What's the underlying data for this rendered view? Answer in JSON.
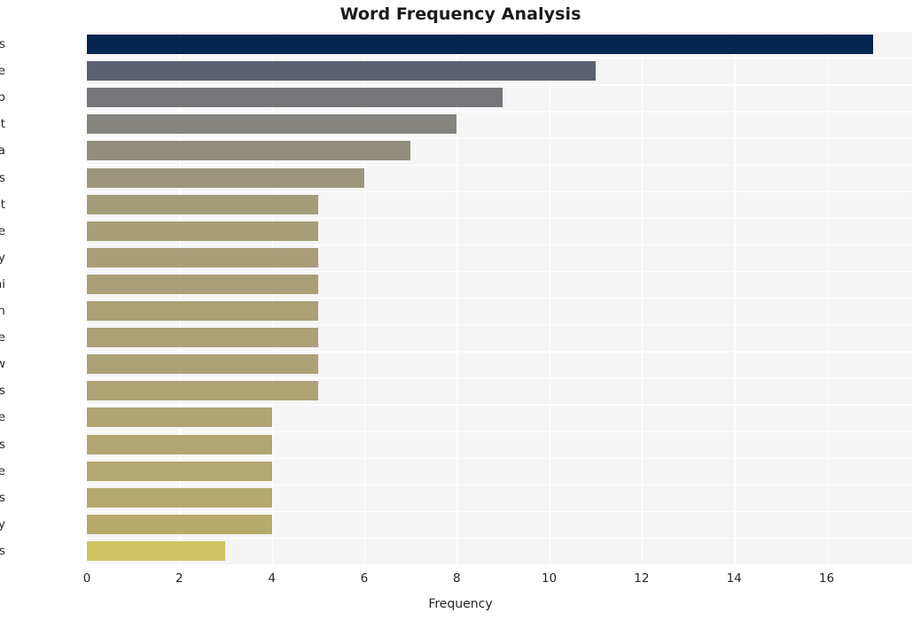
{
  "chart_data": {
    "type": "bar",
    "orientation": "horizontal",
    "title": "Word Frequency Analysis",
    "xlabel": "Frequency",
    "ylabel": "",
    "categories": [
      "defendants",
      "case",
      "trump",
      "right",
      "arizona",
      "dismiss",
      "indictment",
      "state",
      "attorney",
      "giuliani",
      "speech",
      "vote",
      "law",
      "mayes",
      "fake",
      "electors",
      "argue",
      "williams",
      "wednesday",
      "arguments"
    ],
    "values": [
      17,
      11,
      9,
      8,
      7,
      6,
      5,
      5,
      5,
      5,
      5,
      5,
      5,
      5,
      4,
      4,
      4,
      4,
      4,
      3
    ],
    "bar_colors": [
      "#04254f",
      "#5b616f",
      "#75757a",
      "#85847e",
      "#918e80",
      "#9c977c",
      "#a49d79",
      "#a69f78",
      "#a89f78",
      "#a9a077",
      "#aaa177",
      "#aba177",
      "#aca277",
      "#ada375",
      "#b0a572",
      "#b1a671",
      "#b3a870",
      "#b5a96e",
      "#b7ab6c",
      "#cfc463"
    ],
    "xticks": [
      0,
      2,
      4,
      6,
      8,
      10,
      12,
      14,
      16
    ],
    "xlim": [
      0,
      17.85
    ],
    "grid": true,
    "legend": false,
    "plot_background": "#f5f5f6",
    "gridline_color": "#ffffff",
    "figure_background": "#ffffff"
  }
}
